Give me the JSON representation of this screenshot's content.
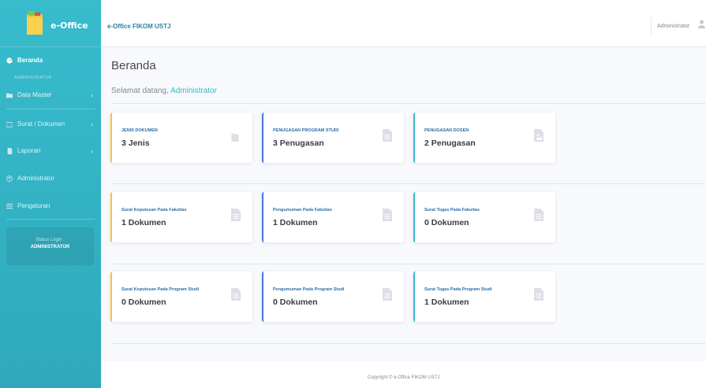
{
  "sidebar": {
    "brand": "e-Office",
    "active_item": "Beranda",
    "section_label": "ADMINISTRATOR",
    "items": [
      {
        "label": "Data Master"
      },
      {
        "label": "Surat / Dokumen"
      },
      {
        "label": "Laporan"
      },
      {
        "label": "Administrator"
      },
      {
        "label": "Pengaturan"
      }
    ],
    "status_label": "Status Login :",
    "status_value": "ADMINISTRATOR"
  },
  "topbar": {
    "title": "e-Office FIKOM USTJ",
    "user": "Administrator"
  },
  "main": {
    "page_title": "Beranda",
    "welcome_prefix": "Selamat datang,",
    "welcome_name": "Administrator",
    "cards": [
      {
        "label": "JENIS DOKUMEN",
        "value": "3 Jenis",
        "icon": "folder-icon"
      },
      {
        "label": "PENUGASAN PROGRAM STUDI",
        "value": "3 Penugasan",
        "icon": "document-icon"
      },
      {
        "label": "PENUGASAN DOSEN",
        "value": "2 Penugasan",
        "icon": "document-icon"
      },
      {
        "label": "Surat Keputusan Pada Fakultas",
        "value": "1 Dokumen",
        "icon": "document-icon"
      },
      {
        "label": "Pengumuman Pada Fakultas",
        "value": "1 Dokumen",
        "icon": "document-icon"
      },
      {
        "label": "Surat Tugas Pada Fakultas",
        "value": "0 Dokumen",
        "icon": "document-icon"
      },
      {
        "label": "Surat Keputusan Pada Program Studi",
        "value": "0 Dokumen",
        "icon": "document-icon"
      },
      {
        "label": "Pengumuman Pada Program Studi",
        "value": "0 Dokumen",
        "icon": "document-icon"
      },
      {
        "label": "Surat Tugas Pada Program Studi",
        "value": "1 Dokumen",
        "icon": "document-icon"
      }
    ]
  },
  "footer": {
    "copyright": "Copyright © e-Office FIKOM USTJ"
  },
  "colors": {
    "sidebar": "#36b9cc",
    "primary": "#4e73df",
    "info": "#36b9cc",
    "warning": "#f6c23e"
  }
}
